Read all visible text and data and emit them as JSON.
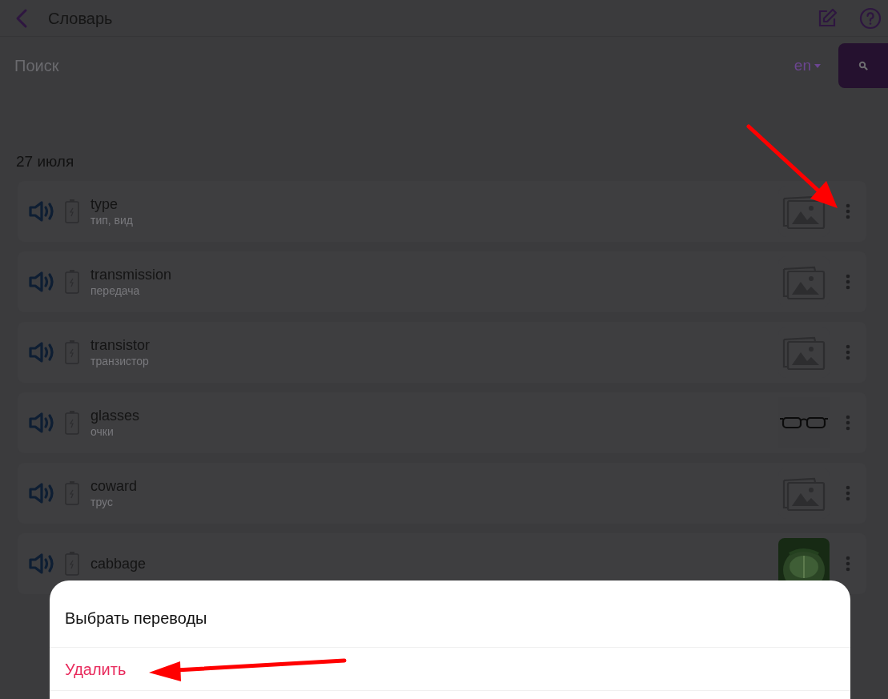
{
  "header": {
    "title": "Словарь"
  },
  "search": {
    "placeholder": "Поиск",
    "language": "en"
  },
  "date_heading": "27 июля",
  "words": [
    {
      "word": "type",
      "translation": "тип, вид",
      "kind": "placeholder"
    },
    {
      "word": "transmission",
      "translation": "передача",
      "kind": "placeholder"
    },
    {
      "word": "transistor",
      "translation": "транзистор",
      "kind": "placeholder"
    },
    {
      "word": "glasses",
      "translation": "очки",
      "kind": "picture"
    },
    {
      "word": "coward",
      "translation": "трус",
      "kind": "placeholder"
    },
    {
      "word": "cabbage",
      "kind": "picture"
    }
  ],
  "action_sheet": {
    "items": [
      {
        "label": "Выбрать переводы",
        "kind": "normal"
      },
      {
        "label": "Удалить",
        "kind": "danger"
      }
    ]
  }
}
